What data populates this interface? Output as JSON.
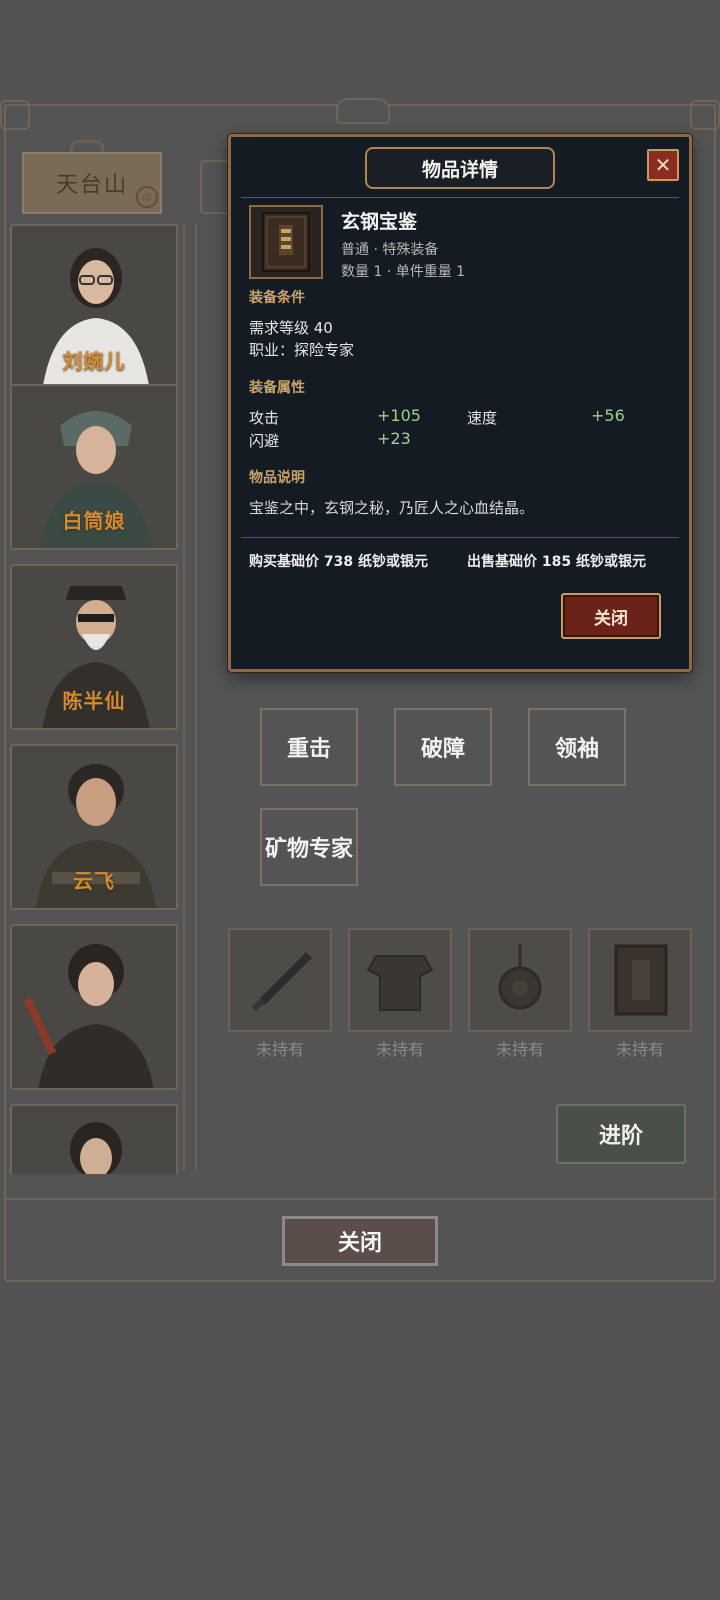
{
  "location_tag": {
    "label": "天台山",
    "stamp": "印"
  },
  "characters": [
    {
      "name": "刘婉儿"
    },
    {
      "name": "白筒娘"
    },
    {
      "name": "陈半仙"
    },
    {
      "name": "云飞"
    },
    {
      "name": ""
    },
    {
      "name": ""
    }
  ],
  "skills": [
    "重击",
    "破障",
    "领袖",
    "矿物专家"
  ],
  "equip_slots": [
    {
      "status": "未持有",
      "icon": "dagger-icon"
    },
    {
      "status": "未持有",
      "icon": "armor-icon"
    },
    {
      "status": "未持有",
      "icon": "amulet-icon"
    },
    {
      "status": "未持有",
      "icon": "book-icon"
    }
  ],
  "advance_label": "进阶",
  "close_label": "关闭",
  "modal": {
    "title": "物品详情",
    "close_x": "✕",
    "item": {
      "name": "玄钢宝鉴",
      "type_line": "普通 · 特殊装备",
      "qty_line": "数量 1 · 单件重量 1",
      "icon": "book-icon"
    },
    "req_header": "装备条件",
    "req_level": "需求等级 40",
    "req_class": "职业：探险专家",
    "attr_header": "装备属性",
    "attrs": [
      {
        "name": "攻击",
        "value": "+105"
      },
      {
        "name": "速度",
        "value": "+56"
      },
      {
        "name": "闪避",
        "value": "+23"
      }
    ],
    "desc_header": "物品说明",
    "desc": "宝鉴之中，玄钢之秘，乃匠人之心血结晶。",
    "buy_price": "购买基础价 738 纸钞或银元",
    "sell_price": "出售基础价 185 纸钞或银元",
    "close_label": "关闭"
  },
  "colors": {
    "accent_gold": "#c9a46a",
    "stat_green": "#9fd08f",
    "name_orange": "#d58a2c",
    "close_red": "#6a2219"
  }
}
